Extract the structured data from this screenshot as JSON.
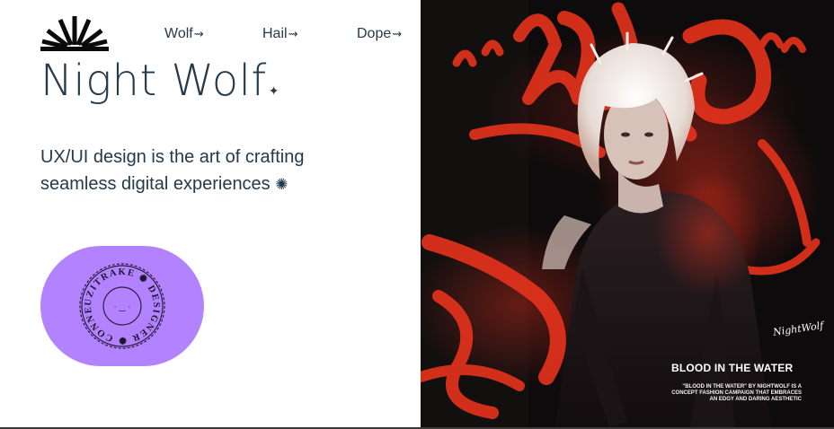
{
  "logo": {
    "icon": "sunburst-logo-icon"
  },
  "nav": [
    {
      "label": "Wolf",
      "arrow": "⇝"
    },
    {
      "label": "Hail",
      "arrow": "⇝"
    },
    {
      "label": "Dope",
      "arrow": "⇝"
    }
  ],
  "hero": {
    "title": "Night Wolf",
    "title_mark": "✦",
    "tagline": "UX/UI design is the art of crafting seamless digital experiences",
    "tagline_mark": "✺"
  },
  "badge": {
    "ring_text": "UZITRAKE ✺ DESIGNER ✺ CONNECT ✺",
    "face": "· ‿ ·",
    "color": "#b383ff"
  },
  "feature": {
    "graffiti": "\"BLOOD\"",
    "signature": "NightWolf",
    "title": "BLOOD IN THE WATER",
    "body": "\"Blood in the water\" by nightwolf is a concept fashion campaign that embraces an edgy and daring aesthetic"
  }
}
